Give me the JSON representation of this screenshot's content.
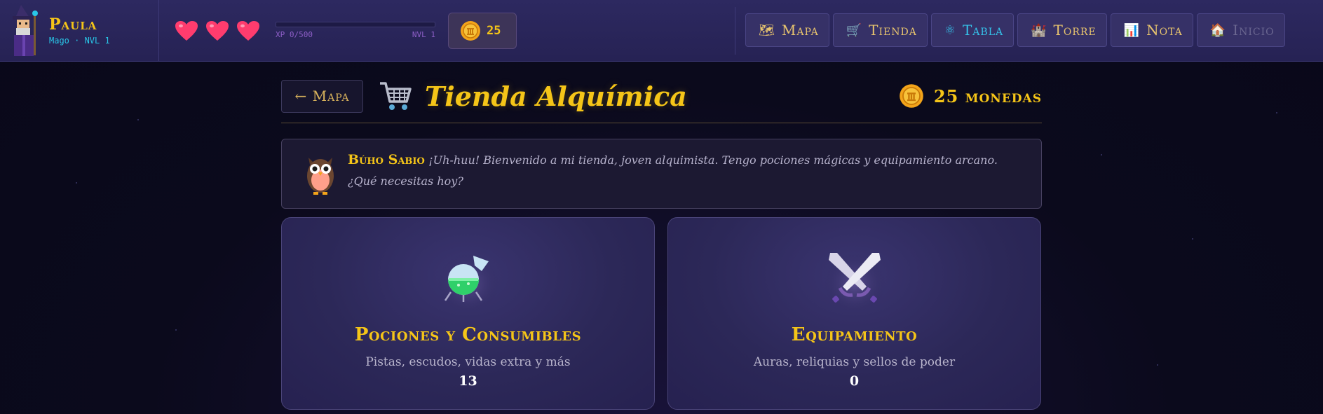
{
  "player": {
    "name": "Paula",
    "subtitle": "Mago · NVL 1",
    "avatar_icon": "wizard-icon"
  },
  "hearts": {
    "count": 3,
    "icon": "heart-icon",
    "color": "#ff3c6e"
  },
  "xp": {
    "label": "XP 0/500",
    "level": "NVL 1",
    "progress": 0
  },
  "coins": {
    "value": "25",
    "icon": "coin-icon"
  },
  "nav": [
    {
      "label": "Mapa",
      "icon": "map-icon",
      "glyph": "🗺",
      "state": "normal"
    },
    {
      "label": "Tienda",
      "icon": "cart-icon",
      "glyph": "🛒",
      "state": "normal"
    },
    {
      "label": "Tabla",
      "icon": "atom-icon",
      "glyph": "⚛",
      "state": "active"
    },
    {
      "label": "Torre",
      "icon": "castle-icon",
      "glyph": "🏰",
      "state": "normal"
    },
    {
      "label": "Nota",
      "icon": "chart-icon",
      "glyph": "📊",
      "state": "normal"
    },
    {
      "label": "Inicio",
      "icon": "home-icon",
      "glyph": "🏠",
      "state": "disabled"
    }
  ],
  "main": {
    "back_label": "← Mapa",
    "title": "Tienda Alquímica",
    "money_label": "25 monedas"
  },
  "owl": {
    "name": "Búho Sabio",
    "message": "¡Uh-huu! Bienvenido a mi tienda, joven alquimista. Tengo pociones mágicas y equipamiento arcano. ¿Qué necesitas hoy?"
  },
  "cards": [
    {
      "title": "Pociones y Consumibles",
      "description": "Pistas, escudos, vidas extra y más",
      "count": "13",
      "icon": "potion-icon"
    },
    {
      "title": "Equipamiento",
      "description": "Auras, reliquias y sellos de poder",
      "count": "0",
      "icon": "crossed-swords-icon"
    }
  ],
  "colors": {
    "accent": "#f5c518",
    "active_nav": "#35c2ea",
    "xp": "#8a4fd0"
  }
}
